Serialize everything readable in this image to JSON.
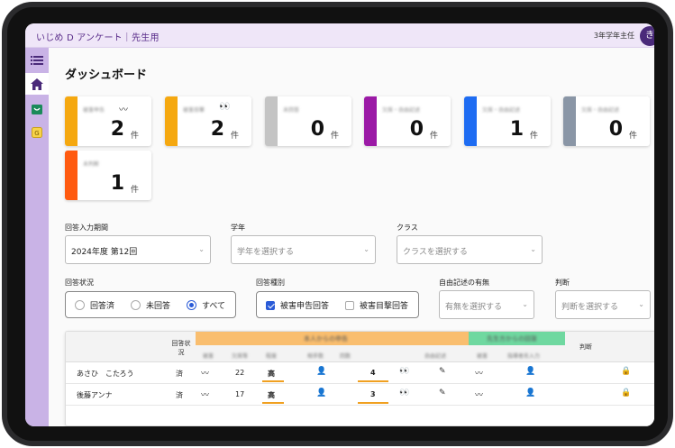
{
  "app": {
    "title": "いじめ D アンケート｜先生用",
    "role": "3年学年主任",
    "avatar_initial": "き"
  },
  "sidebar": {
    "items": [
      "menu-icon",
      "home-icon",
      "message-icon",
      "report-icon"
    ]
  },
  "page": {
    "title": "ダッシュボード"
  },
  "cards": [
    {
      "label": "被害申告",
      "icon": "ribbon-eye-icon",
      "count": "2",
      "unit": "件",
      "color": "#f5a810"
    },
    {
      "label": "被害目撃",
      "icon": "eyes-icon",
      "count": "2",
      "unit": "件",
      "color": "#f5a810"
    },
    {
      "label": "未回答",
      "icon": "",
      "count": "0",
      "unit": "件",
      "color": "#c4c4c4"
    },
    {
      "label": "欠席・自由記述",
      "icon": "",
      "count": "0",
      "unit": "件",
      "color": "#9b1aa6"
    },
    {
      "label": "欠席・自由記述",
      "icon": "",
      "count": "1",
      "unit": "件",
      "color": "#1e6cf2"
    },
    {
      "label": "欠席・自由記述",
      "icon": "",
      "count": "0",
      "unit": "件",
      "color": "#8a96a6"
    },
    {
      "label": "未判断",
      "icon": "",
      "count": "1",
      "unit": "件",
      "color": "#ff5a10"
    }
  ],
  "filters": {
    "period": {
      "label": "回答入力期間",
      "value": "2024年度 第12回"
    },
    "grade": {
      "label": "学年",
      "placeholder": "学年を選択する"
    },
    "class": {
      "label": "クラス",
      "placeholder": "クラスを選択する"
    },
    "status": {
      "label": "回答状況",
      "options": [
        "回答済",
        "未回答",
        "すべて"
      ],
      "selected": "すべて"
    },
    "type": {
      "label": "回答種別",
      "options": [
        "被害申告回答",
        "被害目撃回答"
      ],
      "checked": [
        "被害申告回答"
      ]
    },
    "free": {
      "label": "自由記述の有無",
      "placeholder": "有無を選択する"
    },
    "judge": {
      "label": "判断",
      "placeholder": "判断を選択する"
    }
  },
  "table": {
    "headers": {
      "status": "回答状況",
      "judge": "判断",
      "group_self": "本人からの申告",
      "group_teacher": "先生方からの回答"
    },
    "sub_headers": [
      "被害",
      "欠席等",
      "程度",
      "相手数",
      "回数",
      "自由記述",
      "被害",
      "指導者名入力"
    ],
    "rows": [
      {
        "name": "あさひ　こたろう",
        "status": "済",
        "num1": "22",
        "level": "高",
        "num2": "4"
      },
      {
        "name": "後藤アンナ",
        "status": "済",
        "num1": "17",
        "level": "高",
        "num2": "3"
      }
    ]
  },
  "colors": {
    "accent": "#5a2d8a",
    "sidebar": "#c9b3e6",
    "orange": "#f9be6f",
    "green": "#6fd8a0"
  }
}
